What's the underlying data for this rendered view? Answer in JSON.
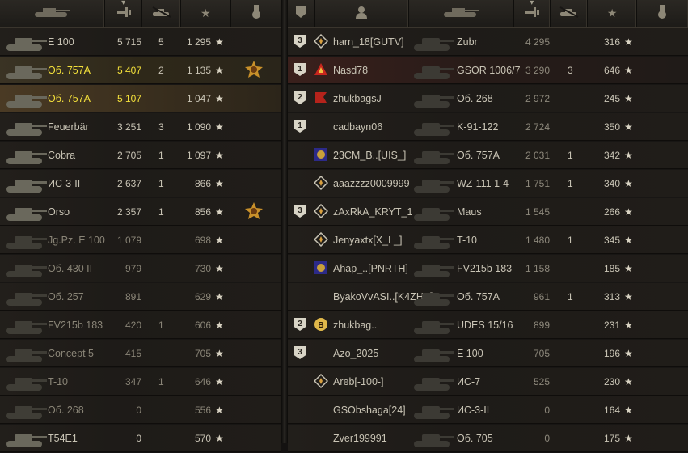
{
  "colors": {
    "accent_yellow": "#f3e03b",
    "text": "#c9c4b5",
    "dim": "#8d887b",
    "bg": "#181614"
  },
  "left": {
    "headers": [
      {
        "name": "tank-column-header",
        "icon": "tank-icon"
      },
      {
        "name": "damage-column-header",
        "icon": "damage-icon",
        "sorted": true
      },
      {
        "name": "kills-column-header",
        "icon": "kills-icon"
      },
      {
        "name": "xp-column-header",
        "icon": "star-icon"
      },
      {
        "name": "medal-column-header",
        "icon": "medal-icon"
      }
    ],
    "rows": [
      {
        "tank": "E 100",
        "damage": "5 715",
        "kills": "5",
        "xp": "1 295",
        "style": "normal",
        "medal": false
      },
      {
        "tank": "Об. 757А",
        "damage": "5 407",
        "kills": "2",
        "xp": "1 135",
        "style": "hl",
        "yellow": true,
        "medal": true
      },
      {
        "tank": "Об. 757А",
        "damage": "5 107",
        "kills": "",
        "xp": "1 047",
        "style": "hl2",
        "yellow": true,
        "medal": false
      },
      {
        "tank": "Feuerbär",
        "damage": "3 251",
        "kills": "3",
        "xp": "1 090",
        "style": "normal",
        "medal": false
      },
      {
        "tank": "Cobra",
        "damage": "2 705",
        "kills": "1",
        "xp": "1 097",
        "style": "normal",
        "medal": false
      },
      {
        "tank": "ИС-3-II",
        "damage": "2 637",
        "kills": "1",
        "xp": "866",
        "style": "normal",
        "medal": false
      },
      {
        "tank": "Orso",
        "damage": "2 357",
        "kills": "1",
        "xp": "856",
        "style": "normal",
        "medal": true
      },
      {
        "tank": "Jg.Pz. E 100",
        "damage": "1 079",
        "kills": "",
        "xp": "698",
        "style": "dim",
        "medal": false
      },
      {
        "tank": "Об. 430 II",
        "damage": "979",
        "kills": "",
        "xp": "730",
        "style": "dim",
        "medal": false
      },
      {
        "tank": "Об. 257",
        "damage": "891",
        "kills": "",
        "xp": "629",
        "style": "dim",
        "medal": false
      },
      {
        "tank": "FV215b 183",
        "damage": "420",
        "kills": "1",
        "xp": "606",
        "style": "dim",
        "medal": false
      },
      {
        "tank": "Concept 5",
        "damage": "415",
        "kills": "",
        "xp": "705",
        "style": "dim",
        "medal": false
      },
      {
        "tank": "T-10",
        "damage": "347",
        "kills": "1",
        "xp": "646",
        "style": "dim",
        "medal": false
      },
      {
        "tank": "Об. 268",
        "damage": "0",
        "kills": "",
        "xp": "556",
        "style": "dim",
        "medal": false
      },
      {
        "tank": "T54E1",
        "damage": "0",
        "kills": "",
        "xp": "570",
        "style": "normal",
        "medal": false
      }
    ]
  },
  "right": {
    "headers": [
      {
        "name": "platoon-column-header",
        "icon": "shield-icon"
      },
      {
        "name": "player-column-header",
        "icon": "person-icon"
      },
      {
        "name": "tank-column-header",
        "icon": "tank-icon"
      },
      {
        "name": "damage-column-header",
        "icon": "damage-icon",
        "sorted": true
      },
      {
        "name": "kills-column-header",
        "icon": "kills-icon"
      },
      {
        "name": "xp-column-header",
        "icon": "star-icon"
      },
      {
        "name": "medal-column-header",
        "icon": "medal-icon"
      }
    ],
    "rows": [
      {
        "rank": "3",
        "clan": "diamond",
        "player": "harn_18[GUTV]",
        "tank": "Zubr",
        "damage": "4 295",
        "kills": "",
        "xp": "316"
      },
      {
        "rank": "1",
        "clan": "red-triangle",
        "player": "Nasd78",
        "tank": "GSOR 1006/7",
        "damage": "3 290",
        "kills": "3",
        "xp": "646",
        "style": "red"
      },
      {
        "rank": "2",
        "clan": "red-flag",
        "player": "zhukbagsJ",
        "tank": "Об. 268",
        "damage": "2 972",
        "kills": "",
        "xp": "245"
      },
      {
        "rank": "1",
        "clan": "",
        "player": "cadbayn06",
        "tank": "K-91-122",
        "damage": "2 724",
        "kills": "",
        "xp": "350"
      },
      {
        "rank": "",
        "clan": "gold-flag",
        "player": "23CM_B..[UIS_]",
        "tank": "Об. 757А",
        "damage": "2 031",
        "kills": "1",
        "xp": "342"
      },
      {
        "rank": "",
        "clan": "diamond",
        "player": "aaazzzz0009999",
        "tank": "WZ-111 1-4",
        "damage": "1 751",
        "kills": "1",
        "xp": "340"
      },
      {
        "rank": "3",
        "clan": "diamond",
        "player": "zAxRkA_KRYT_1",
        "tank": "Maus",
        "damage": "1 545",
        "kills": "",
        "xp": "266"
      },
      {
        "rank": "",
        "clan": "diamond",
        "player": "Jenyaxtx[X_L_]",
        "tank": "T-10",
        "damage": "1 480",
        "kills": "1",
        "xp": "345"
      },
      {
        "rank": "",
        "clan": "gold-flag",
        "player": "Ahap_..[PNRTH]",
        "tank": "FV215b 183",
        "damage": "1 158",
        "kills": "",
        "xp": "185"
      },
      {
        "rank": "",
        "clan": "",
        "player": "ByakoVvASI..[K4ZHA]",
        "tank": "Об. 757А",
        "damage": "961",
        "kills": "1",
        "xp": "313"
      },
      {
        "rank": "2",
        "clan": "b-badge",
        "player": "zhukbag..",
        "tank": "UDES 15/16",
        "damage": "899",
        "kills": "",
        "xp": "231"
      },
      {
        "rank": "3",
        "clan": "",
        "player": "Azo_2025",
        "tank": "E 100",
        "damage": "705",
        "kills": "",
        "xp": "196"
      },
      {
        "rank": "",
        "clan": "diamond",
        "player": "Areb[-100-]",
        "tank": "ИС-7",
        "damage": "525",
        "kills": "",
        "xp": "230"
      },
      {
        "rank": "",
        "clan": "",
        "player": "GSObshaga[24]",
        "tank": "ИС-3-II",
        "damage": "0",
        "kills": "",
        "xp": "164"
      },
      {
        "rank": "",
        "clan": "",
        "player": "Zver199991",
        "tank": "Об. 705",
        "damage": "0",
        "kills": "",
        "xp": "175"
      }
    ]
  }
}
